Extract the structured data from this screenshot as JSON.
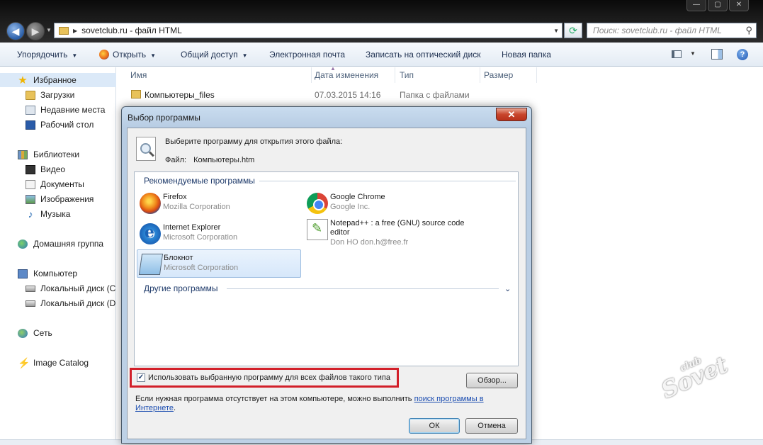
{
  "window": {
    "controls": [
      "—",
      "▢",
      "✕"
    ]
  },
  "address": {
    "path": "sovetclub.ru ▸ файл HTML",
    "path_text": "sovetclub.ru - файл HTML"
  },
  "search": {
    "placeholder": "Поиск: sovetclub.ru - файл HTML"
  },
  "toolbar": {
    "organize": "Упорядочить",
    "open": "Открыть",
    "share": "Общий доступ",
    "email": "Электронная почта",
    "burn": "Записать на оптический диск",
    "new_folder": "Новая папка"
  },
  "sidebar": {
    "items": [
      {
        "label": "Избранное",
        "icon": "star-icon"
      },
      {
        "label": "Загрузки",
        "icon": "downloads-folder-icon"
      },
      {
        "label": "Недавние места",
        "icon": "recent-places-icon"
      },
      {
        "label": "Рабочий стол",
        "icon": "desktop-icon"
      },
      {
        "label": "Библиотеки",
        "icon": "libraries-icon"
      },
      {
        "label": "Видео",
        "icon": "video-icon"
      },
      {
        "label": "Документы",
        "icon": "documents-icon"
      },
      {
        "label": "Изображения",
        "icon": "pictures-icon"
      },
      {
        "label": "Музыка",
        "icon": "music-icon"
      },
      {
        "label": "Домашняя группа",
        "icon": "homegroup-icon"
      },
      {
        "label": "Компьютер",
        "icon": "computer-icon"
      },
      {
        "label": "Локальный диск (C",
        "icon": "disk-icon"
      },
      {
        "label": "Локальный диск (D",
        "icon": "disk-icon"
      },
      {
        "label": "Сеть",
        "icon": "network-icon"
      },
      {
        "label": "Image Catalog",
        "icon": "image-catalog-icon"
      }
    ]
  },
  "file_list": {
    "columns": [
      "Имя",
      "Дата изменения",
      "Тип",
      "Размер"
    ],
    "rows": [
      {
        "name": "Компьютеры_files",
        "date": "07.03.2015 14:16",
        "type": "Папка с файлами",
        "size": ""
      }
    ]
  },
  "dialog": {
    "title": "Выбор программы",
    "close": "✕",
    "intro": "Выберите программу для открытия этого файла:",
    "file_label": "Файл:",
    "file_name": "Компьютеры.htm",
    "recommended_label": "Рекомендуемые программы",
    "other_label": "Другие программы",
    "programs": [
      {
        "name": "Firefox",
        "vendor": "Mozilla Corporation",
        "icon": "firefox-icon"
      },
      {
        "name": "Google Chrome",
        "vendor": "Google Inc.",
        "icon": "chrome-icon"
      },
      {
        "name": "Internet Explorer",
        "vendor": "Microsoft Corporation",
        "icon": "ie-icon"
      },
      {
        "name": "Notepad++ : a free (GNU) source code editor",
        "vendor": "Don HO don.h@free.fr",
        "icon": "notepadpp-icon"
      },
      {
        "name": "Блокнот",
        "vendor": "Microsoft Corporation",
        "icon": "notepad-icon"
      }
    ],
    "always_use_checked": true,
    "always_use_label": "Использовать выбранную программу для всех файлов такого типа",
    "browse": "Обзор...",
    "note_text": "Если нужная программа отсутствует на этом компьютере, можно выполнить ",
    "note_link": "поиск программы в Интернете",
    "note_end": ".",
    "ok": "ОК",
    "cancel": "Отмена"
  },
  "watermark": {
    "small": "club",
    "big": "Sovet"
  }
}
